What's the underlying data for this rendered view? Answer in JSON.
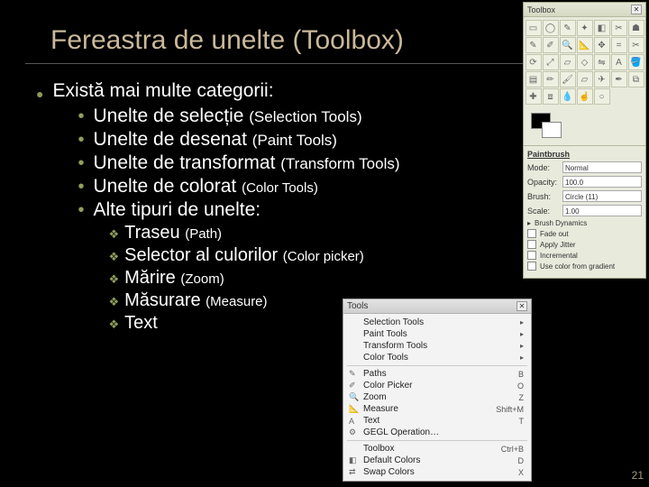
{
  "title": "Fereastra de unelte (Toolbox)",
  "intro": "Există mai multe categorii:",
  "categories": [
    {
      "label": "Unelte de selecție",
      "paren": "(Selection Tools)",
      "small": false
    },
    {
      "label": "Unelte de desenat",
      "paren": "(Paint Tools)",
      "small": false
    },
    {
      "label": "Unelte de transformat",
      "paren": "(Transform Tools)",
      "small": false
    },
    {
      "label": "Unelte de colorat",
      "paren": "(Color Tools)",
      "small": true
    },
    {
      "label": "Alte tipuri de unelte:",
      "paren": "",
      "small": false
    }
  ],
  "other_tools": [
    {
      "label": "Traseu",
      "paren": "(Path)"
    },
    {
      "label": "Selector al culorilor",
      "paren": "(Color picker)"
    },
    {
      "label": "Mărire",
      "paren": "(Zoom)"
    },
    {
      "label": "Măsurare",
      "paren": "(Measure)"
    },
    {
      "label": "Text",
      "paren": ""
    }
  ],
  "toolbox": {
    "title": "Toolbox",
    "close": "✕",
    "options_title": "Paintbrush",
    "mode_label": "Mode:",
    "mode_value": "Normal",
    "opacity_label": "Opacity:",
    "opacity_value": "100.0",
    "brush_label": "Brush:",
    "brush_value": "Circle (11)",
    "scale_label": "Scale:",
    "scale_value": "1.00",
    "cb1": "Brush Dynamics",
    "cb2": "Fade out",
    "cb3": "Apply Jitter",
    "cb4": "Incremental",
    "cb5": "Use color from gradient"
  },
  "tools_menu": {
    "title": "Tools",
    "items_top": [
      "Selection Tools",
      "Paint Tools",
      "Transform Tools",
      "Color Tools"
    ],
    "items_mid": [
      {
        "label": "Paths",
        "sc": "B"
      },
      {
        "label": "Color Picker",
        "sc": "O"
      },
      {
        "label": "Zoom",
        "sc": "Z"
      },
      {
        "label": "Measure",
        "sc": "Shift+M"
      },
      {
        "label": "Text",
        "sc": "T"
      },
      {
        "label": "GEGL Operation…",
        "sc": ""
      }
    ],
    "items_bot": [
      {
        "label": "Toolbox",
        "sc": "Ctrl+B"
      },
      {
        "label": "Default Colors",
        "sc": "D"
      },
      {
        "label": "Swap Colors",
        "sc": "X"
      }
    ]
  },
  "page_number": "21"
}
